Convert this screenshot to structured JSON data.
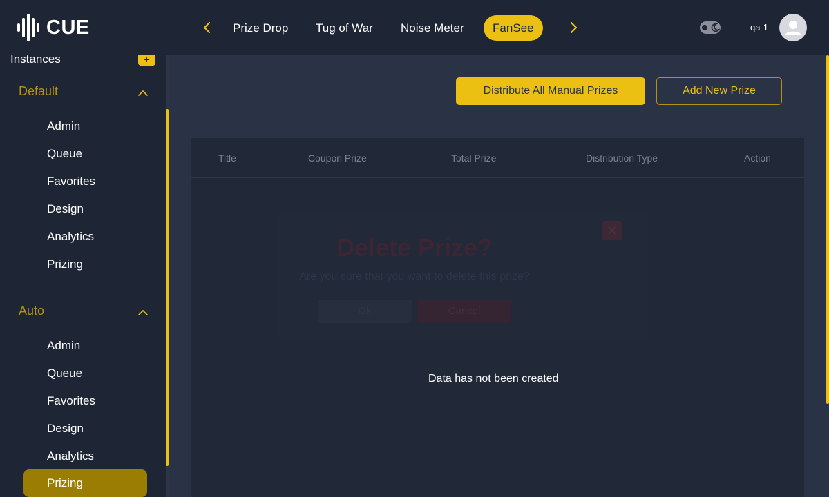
{
  "brand": {
    "logo_text": "CUE",
    "accent_color": "#ebc012"
  },
  "nav": {
    "prev_icon": "chevron-left-icon",
    "next_icon": "chevron-right-icon",
    "tabs": [
      {
        "label": "Prize Drop",
        "active": false
      },
      {
        "label": "Tug of War",
        "active": false
      },
      {
        "label": "Noise Meter",
        "active": false
      },
      {
        "label": "FanSee",
        "active": true
      }
    ]
  },
  "user": {
    "name": "qa-1",
    "theme_toggle_icon": "moon-icon",
    "avatar_icon": "user-icon"
  },
  "sidebar": {
    "instances_label": "Instances",
    "add_label": "+",
    "groups": [
      {
        "title": "Default",
        "expanded": true,
        "items": [
          "Admin",
          "Queue",
          "Favorites",
          "Design",
          "Analytics",
          "Prizing"
        ]
      },
      {
        "title": "Auto",
        "expanded": true,
        "items": [
          "Admin",
          "Queue",
          "Favorites",
          "Design",
          "Analytics",
          "Prizing"
        ],
        "active_item": "Prizing"
      }
    ]
  },
  "main": {
    "distribute_button": "Distribute All Manual Prizes",
    "add_prize_button": "Add New Prize",
    "table": {
      "columns": [
        "Title",
        "Coupon Prize",
        "Total Prize",
        "Distribution Type",
        "Action"
      ],
      "rows": [],
      "empty_message": "Data has not been created"
    },
    "dialog": {
      "title": "Delete Prize?",
      "message": "Are you sure that you want to delete this prize?",
      "ok_label": "Ok",
      "cancel_label": "Cancel",
      "close_icon": "close-icon"
    }
  }
}
